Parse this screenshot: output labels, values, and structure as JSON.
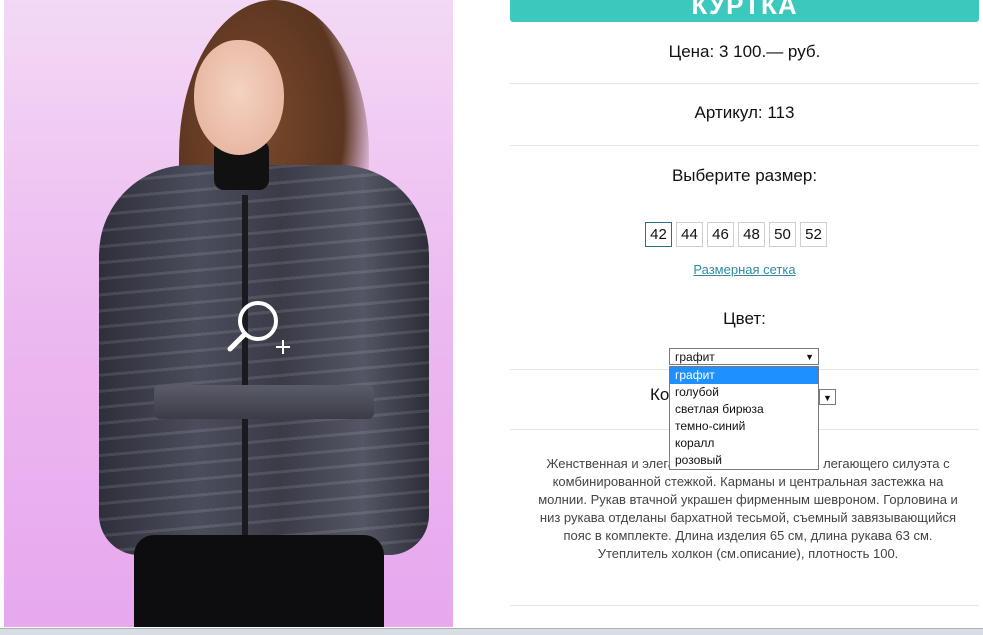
{
  "product": {
    "title": "КУРТКА",
    "price": "Цена: 3 100.— руб.",
    "article": "Артикул: 113",
    "size_heading": "Выберите размер:",
    "sizes": [
      "42",
      "44",
      "46",
      "48",
      "50",
      "52"
    ],
    "selected_size": "42",
    "size_chart_link": "Размерная сетка",
    "color_heading": "Цвет:",
    "color_selected": "графит",
    "color_options": [
      "графит",
      "голубой",
      "светлая бирюза",
      "темно-синий",
      "коралл",
      "розовый"
    ],
    "quantity_label": "Ко",
    "description_lines": [
      "Женственная и элега",
      "легающего силуэта с",
      "комбинированной стежкой. Карманы и центральная застежка на",
      "молнии. Рукав втачной украшен фирменным шевроном. Горловина и",
      "низ рукава отделаны бархатной тесьмой, съемный завязывающийся",
      "пояс в комплекте. Длина изделия 65 см, длина рукава 63 см.",
      "Утеплитель холкон (см.описание), плотность 100."
    ]
  },
  "colors": {
    "accent": "#3cc8bd",
    "link": "#2f8ba2",
    "highlight": "#1e90ff"
  },
  "icons": {
    "zoom": "magnifier-plus-icon"
  }
}
